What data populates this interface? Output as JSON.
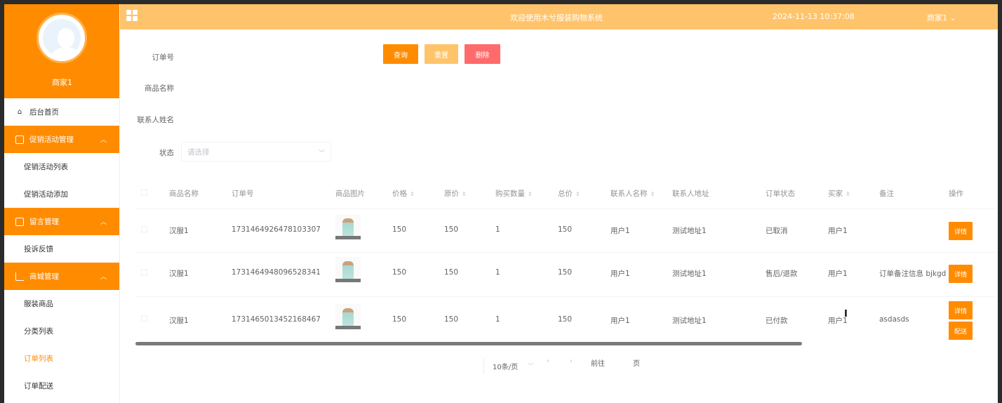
{
  "header": {
    "title": "欢迎使用木兮服装购物系统",
    "datetime": "2024-11-13 10:37:08",
    "user": "商家1 ⌄"
  },
  "sidebar": {
    "profile_name": "商家1",
    "home": "后台首页",
    "groups": [
      {
        "label": "促销活动管理",
        "items": [
          "促销活动列表",
          "促销活动添加"
        ]
      },
      {
        "label": "留言管理",
        "items": [
          "投诉反馈"
        ]
      },
      {
        "label": "商城管理",
        "items": [
          "服装商品",
          "分类列表",
          "订单列表",
          "订单配送"
        ]
      }
    ]
  },
  "search": {
    "order_no_label": "订单号",
    "product_name_label": "商品名称",
    "contact_name_label": "联系人姓名",
    "status_label": "状态",
    "status_placeholder": "请选择",
    "query_button": "查询",
    "reset_button": "重置",
    "delete_button": "删除"
  },
  "table": {
    "columns": [
      "商品名称",
      "订单号",
      "商品图片",
      "价格",
      "原价",
      "购买数量",
      "总价",
      "联系人名称",
      "联系人地址",
      "订单状态",
      "买家",
      "备注",
      "操作"
    ],
    "rows": [
      {
        "product": "汉服1",
        "order_no": "1731464926478103307",
        "price": "150",
        "original_price": "150",
        "quantity": "1",
        "total": "150",
        "contact": "用户1",
        "address": "测试地址1",
        "status": "已取消",
        "buyer": "用户1",
        "remark": "",
        "actions": [
          "详情"
        ]
      },
      {
        "product": "汉服1",
        "order_no": "1731464948096528341",
        "price": "150",
        "original_price": "150",
        "quantity": "1",
        "total": "150",
        "contact": "用户1",
        "address": "测试地址1",
        "status": "售后/退款",
        "buyer": "用户1",
        "remark": "订单备注信息 bjkgd",
        "actions": [
          "详情"
        ]
      },
      {
        "product": "汉服1",
        "order_no": "1731465013452168467",
        "price": "150",
        "original_price": "150",
        "quantity": "1",
        "total": "150",
        "contact": "用户1",
        "address": "测试地址1",
        "status": "已付款",
        "buyer": "用户1",
        "remark": "asdasds",
        "actions": [
          "详情",
          "配送"
        ]
      }
    ]
  },
  "pagination": {
    "page_size": "10条/页",
    "goto_label": "前往",
    "page_suffix": "页"
  },
  "colors": {
    "accent": "#ff8c00",
    "header": "#ffc46b",
    "danger": "#ff6b6b"
  }
}
